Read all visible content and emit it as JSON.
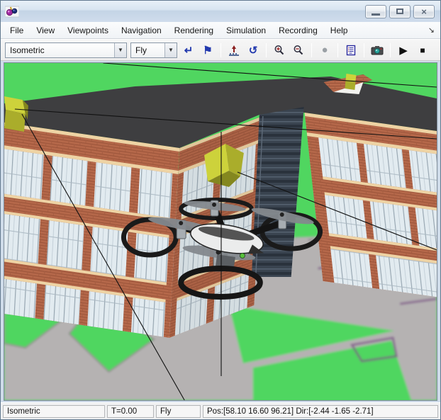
{
  "window": {
    "title": "",
    "app_icon": "vr-world-icon",
    "controls": {
      "close_glyph": "×"
    }
  },
  "menu": {
    "items": [
      "File",
      "View",
      "Viewpoints",
      "Navigation",
      "Rendering",
      "Simulation",
      "Recording",
      "Help"
    ],
    "dock_arrow_glyph": "↘"
  },
  "toolbar": {
    "viewpoint_dropdown": {
      "value": "Isometric",
      "arrow_glyph": "▼"
    },
    "navigation_dropdown": {
      "value": "Fly",
      "arrow_glyph": "▼"
    },
    "icons": {
      "return_to_viewpoint_glyph": "↵",
      "create_viewpoint_glyph": "⚑",
      "undo_move_glyph": "↺",
      "record_glyph": "●",
      "play_glyph": "▶",
      "stop_glyph": "■"
    }
  },
  "statusbar": {
    "viewpoint": "Isometric",
    "time": "T=0.00",
    "navigation_mode": "Fly",
    "position": "Pos:[58.10 16.60 96.21] Dir:[-2.44 -1.65 -2.71]"
  },
  "scene": {
    "objects": [
      "office-building",
      "quadcopter-drone",
      "waypoint-cube-left",
      "waypoint-cube-center",
      "waypoint-cube-roof",
      "trajectory-lines",
      "parking-lot"
    ],
    "colors": {
      "grass": "#50d660",
      "roof": "#3e3e40",
      "brick": "#b5684a",
      "trim": "#eed3a4",
      "glass": "#e2ebf0",
      "dark_glass": "#3a4450",
      "waypoint_bright": "#cdd23b",
      "waypoint_mid": "#aaad2b",
      "waypoint_dark": "#84871f",
      "pavement": "#b5b2b2",
      "marking": "#7b5185",
      "line": "#111111"
    }
  }
}
